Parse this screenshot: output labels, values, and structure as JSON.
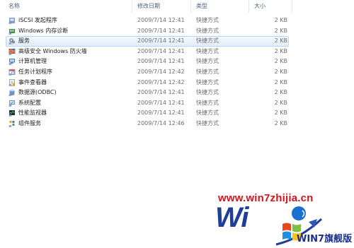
{
  "columns": {
    "name": "名称",
    "date": "修改日期",
    "type": "类型",
    "size": "大小"
  },
  "rows": [
    {
      "name": "iSCSI 发起程序",
      "date": "2009/7/14 12:41",
      "type": "快捷方式",
      "size": "2 KB",
      "icon": "iscsi-icon"
    },
    {
      "name": "Windows 内存诊断",
      "date": "2009/7/14 12:41",
      "type": "快捷方式",
      "size": "2 KB",
      "icon": "memory-diagnostic-icon"
    },
    {
      "name": "服务",
      "date": "2009/7/14 12:41",
      "type": "快捷方式",
      "size": "2 KB",
      "icon": "services-icon",
      "selected": true
    },
    {
      "name": "高级安全 Windows 防火墙",
      "date": "2009/7/14 12:41",
      "type": "快捷方式",
      "size": "2 KB",
      "icon": "firewall-icon"
    },
    {
      "name": "计算机管理",
      "date": "2009/7/14 12:41",
      "type": "快捷方式",
      "size": "2 KB",
      "icon": "computer-management-icon"
    },
    {
      "name": "任务计划程序",
      "date": "2009/7/14 12:42",
      "type": "快捷方式",
      "size": "2 KB",
      "icon": "task-scheduler-icon"
    },
    {
      "name": "事件查看器",
      "date": "2009/7/14 12:42",
      "type": "快捷方式",
      "size": "2 KB",
      "icon": "event-viewer-icon"
    },
    {
      "name": "数据源(ODBC)",
      "date": "2009/7/14 12:41",
      "type": "快捷方式",
      "size": "2 KB",
      "icon": "odbc-icon"
    },
    {
      "name": "系统配置",
      "date": "2009/7/14 12:41",
      "type": "快捷方式",
      "size": "2 KB",
      "icon": "system-config-icon"
    },
    {
      "name": "性能监视器",
      "date": "2009/7/14 12:41",
      "type": "快捷方式",
      "size": "2 KB",
      "icon": "performance-monitor-icon"
    },
    {
      "name": "组件服务",
      "date": "2009/7/14 12:46",
      "type": "快捷方式",
      "size": "2 KB",
      "icon": "component-services-icon"
    }
  ],
  "watermark": {
    "url": "www.win7zhijia.cn",
    "big_text": "Wi",
    "logo_text": "WIN7旗舰版"
  },
  "colors": {
    "header_text": "#4c607a",
    "selection_border": "#b8d6fb",
    "watermark_red": "#d2141c",
    "watermark_blue": "#1f3e96"
  }
}
